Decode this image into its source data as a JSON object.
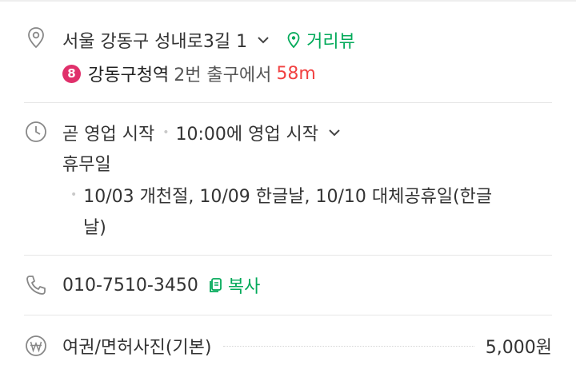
{
  "address": {
    "text": "서울 강동구 성내로3길 1",
    "street_view_label": "거리뷰",
    "subway": {
      "line": "8",
      "line_color": "#e0306b",
      "station": "강동구청역",
      "exit_text": "2번 출구에서",
      "distance": "58m"
    }
  },
  "hours": {
    "status": "곧 영업 시작",
    "detail": "10:00에 영업 시작",
    "closed_label": "휴무일",
    "holidays_line1": "10/03 개천절, 10/09 한글날, 10/10 대체공휴일(한글",
    "holidays_line2": "날)"
  },
  "phone": {
    "number": "010-7510-3450",
    "copy_label": "복사"
  },
  "price": {
    "item": "여권/면허사진(기본)",
    "amount": "5,000원"
  },
  "colors": {
    "accent_green": "#03aa5a",
    "distance_red": "#f14141",
    "divider": "#e6e6e6"
  },
  "icons": [
    "location-pin-icon",
    "street-view-pin-icon",
    "clock-icon",
    "phone-icon",
    "copy-icon",
    "won-icon",
    "chevron-down-icon"
  ]
}
